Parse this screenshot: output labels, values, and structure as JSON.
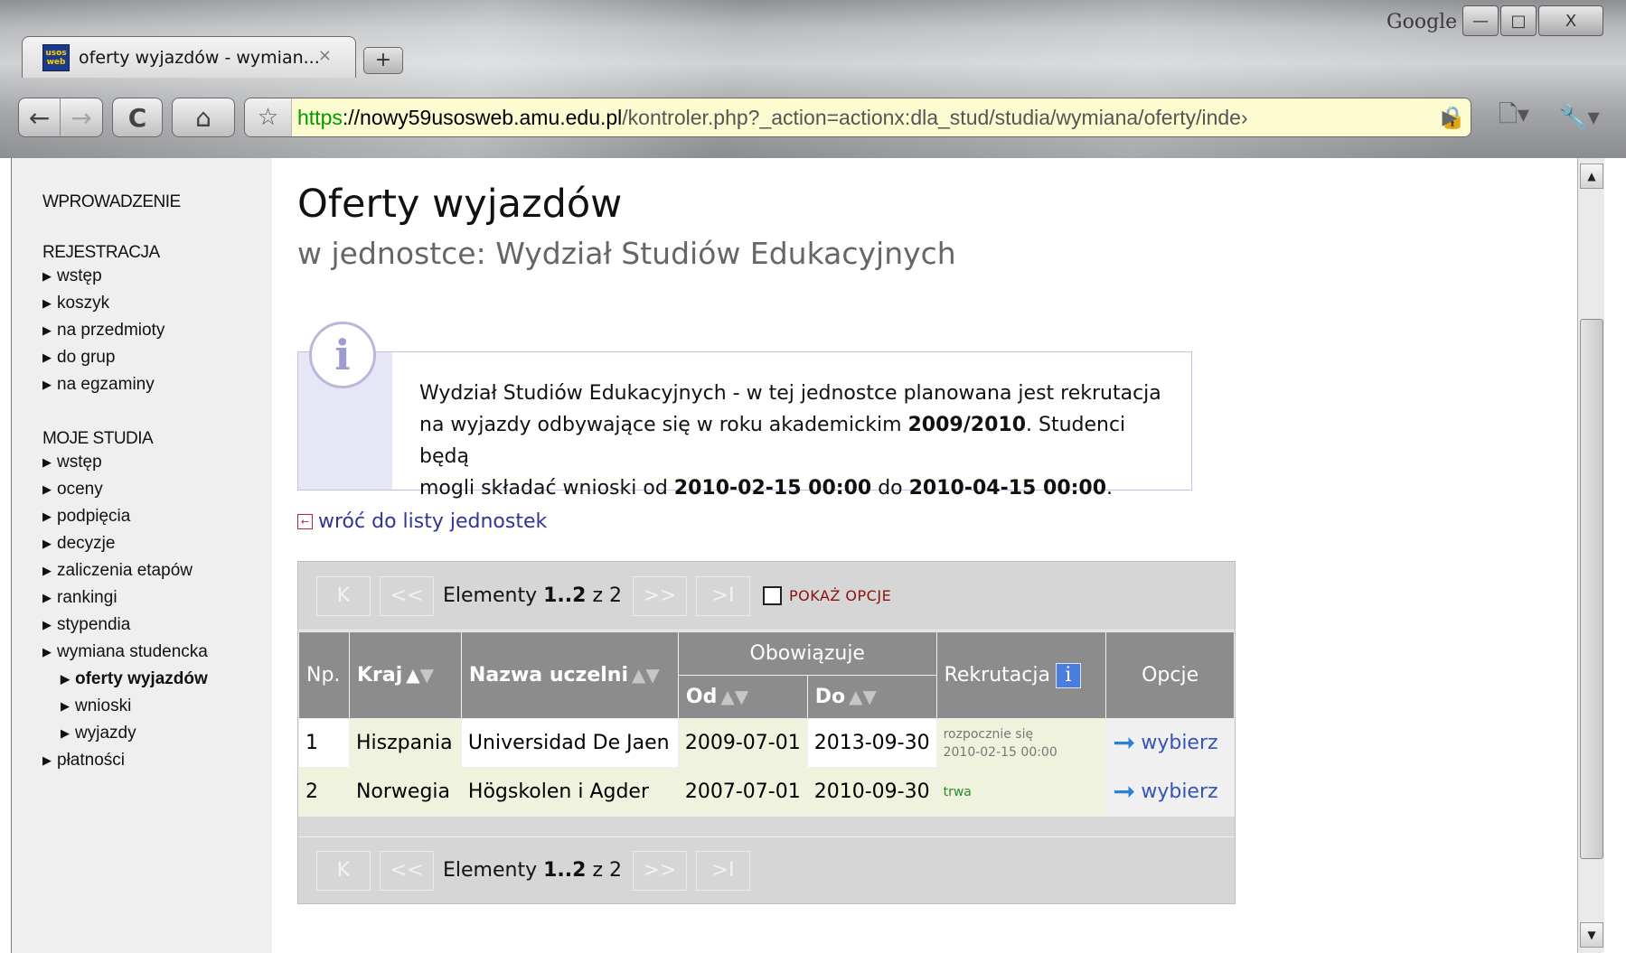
{
  "window": {
    "brand": "Google",
    "minimize": "—",
    "maximize": "□",
    "close": "X"
  },
  "tab": {
    "favicon_text": "usos web",
    "title": "oferty wyjazdów - wymian...",
    "close": "×",
    "new_tab": "+"
  },
  "toolbar": {
    "back": "←",
    "forward": "→",
    "reload": "C",
    "home": "⌂",
    "star": "☆",
    "url_scheme": "https",
    "url_host": "://nowy59usosweb.amu.edu.pl",
    "url_path": "/kontroler.php?_action=actionx:dla_stud/studia/wymiana/oferty/inde›",
    "lock": "🔒",
    "go": "▶",
    "page_menu": "🗋▾",
    "tools_menu": "🔧▾"
  },
  "sidebar": {
    "sections": [
      {
        "heading": "WPROWADZENIE",
        "items": []
      },
      {
        "heading": "REJESTRACJA",
        "items": [
          "wstęp",
          "koszyk",
          "na przedmioty",
          "do grup",
          "na egzaminy"
        ]
      },
      {
        "heading": "MOJE STUDIA",
        "items": [
          "wstęp",
          "oceny",
          "podpięcia",
          "decyzje",
          "zaliczenia etapów",
          "rankingi",
          "stypendia",
          "wymiana studencka"
        ]
      }
    ],
    "sub_items": [
      "oferty wyjazdów",
      "wnioski",
      "wyjazdy"
    ],
    "last_item": "płatności"
  },
  "main": {
    "title": "Oferty wyjazdów",
    "subtitle": "w jednostce: Wydział Studiów Edukacyjnych",
    "info": {
      "icon": "i",
      "line1": "Wydział Studiów Edukacyjnych - w tej jednostce planowana jest rekrutacja",
      "line2_a": "na wyjazdy odbywające się w roku akademickim ",
      "line2_year": "2009/2010",
      "line2_b": ". Studenci będą",
      "line3_a": "mogli składać wnioski od ",
      "line3_from": "2010-02-15 00:00",
      "line3_mid": " do ",
      "line3_to": "2010-04-15 00:00",
      "line3_end": "."
    },
    "back_link": "wróć do listy jednostek",
    "back_icon": "←"
  },
  "pager": {
    "first": "K",
    "prev": "<<",
    "next": ">>",
    "last": ">I",
    "label": "Elementy ",
    "range": "1..2",
    "of": " z 2",
    "show_options": "POKAŻ OPCJE"
  },
  "table": {
    "headers": {
      "np": "Np.",
      "kraj": "Kraj",
      "uczelnia": "Nazwa uczelni",
      "obowiazuje": "Obowiązuje",
      "od": "Od",
      "do": "Do",
      "rekrutacja": "Rekrutacja",
      "rekrutacja_info": "i",
      "opcje": "Opcje"
    },
    "sort_up": "▲",
    "sort_down": "▼",
    "rows": [
      {
        "np": "1",
        "kraj": "Hiszpania",
        "uczelnia": "Universidad De Jaen",
        "od": "2009-07-01",
        "do": "2013-09-30",
        "rekrutacja_1": "rozpocznie się",
        "rekrutacja_2": "2010-02-15 00:00",
        "opcja": "wybierz"
      },
      {
        "np": "2",
        "kraj": "Norwegia",
        "uczelnia": "Högskolen i Agder",
        "od": "2007-07-01",
        "do": "2010-09-30",
        "rekrutacja_1": "trwa",
        "rekrutacja_2": "",
        "opcja": "wybierz"
      }
    ],
    "choose_arrow": "➞"
  },
  "scrollbar": {
    "up": "▲",
    "down": "▼"
  }
}
